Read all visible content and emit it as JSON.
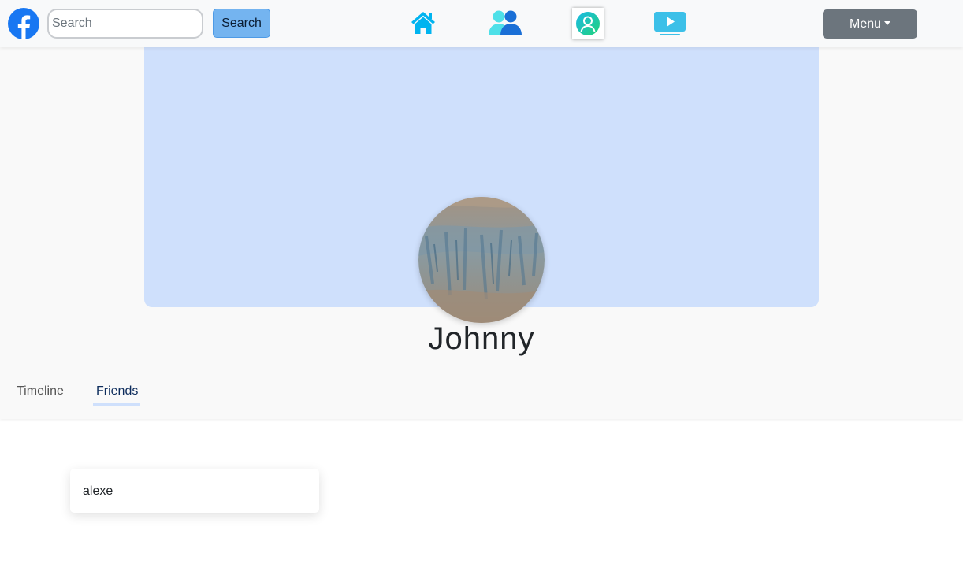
{
  "navbar": {
    "logo_icon": "facebook-logo-icon",
    "search": {
      "placeholder": "Search",
      "value": ""
    },
    "search_button_label": "Search",
    "nav_items": [
      {
        "icon": "home-icon",
        "active": false
      },
      {
        "icon": "friends-icon",
        "active": false
      },
      {
        "icon": "profile-icon",
        "active": true
      },
      {
        "icon": "watch-icon",
        "active": false
      }
    ],
    "menu_label": "Menu"
  },
  "profile": {
    "name": "Johnny",
    "cover_color": "#cfe0fc"
  },
  "tabs": [
    {
      "label": "Timeline",
      "active": false
    },
    {
      "label": "Friends",
      "active": true
    }
  ],
  "friends": [
    {
      "name": "alexe"
    }
  ],
  "colors": {
    "brand": "#1877f2",
    "accent": "#00b4f0",
    "search_button": "#74b4f0",
    "menu_button": "#6c757d"
  }
}
